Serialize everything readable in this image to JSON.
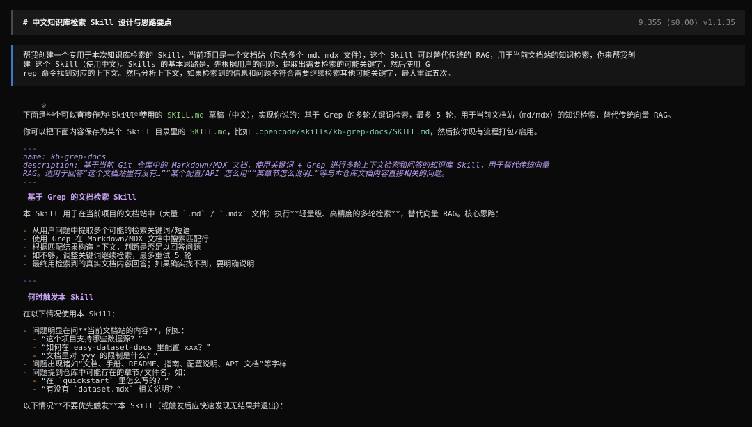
{
  "header": {
    "title": "# 中文知识库检索 Skill 设计与思路要点",
    "meta": "9,355 ($0.00) v1.1.35"
  },
  "prompt": {
    "lines": [
      "帮我创建一个专用于本次知识库检索的 Skill，当前项目是一个文档站（包含多个 md、mdx 文件），这个 Skill 可以替代传统的 RAG，用于当前文档站的知识检索，你来帮我创",
      "建 这个 Skill（使用中文）。Skills 的基本思路是，先根据用户的问题，提取出需要检索的可能关键字，然后使用 G",
      "rep 命令找到对应的上下文。然后分析上下文，如果检索到的信息和问题不符合需要继续检索其他可能关键字，最大重试五次。"
    ]
  },
  "tool_call": {
    "icon": "gear-icon",
    "label": "skill [name=skill-creator]"
  },
  "response": {
    "intro1_a": "下面是一个可以直接作为 Skill 使用的 ",
    "intro1_file": "SKILL.md",
    "intro1_b": " 草稿（中文），实现你说的：基于 Grep 的多轮关键词检索，最多 5 轮，用于当前文档站（md/mdx）的知识检索，替代传统向量 RAG。",
    "intro2_a": "你可以把下面内容保存为某个 Skill 目录里的 ",
    "intro2_file": "SKILL.md",
    "intro2_b": "，比如 ",
    "intro2_path": ".opencode/skills/kb-grep-docs/SKILL.md",
    "intro2_c": "，然后按你现有流程打包/启用。",
    "fm_rule_top": "---",
    "fm_name": "name: kb-grep-docs",
    "fm_desc1": "description: 基于当前 Git 仓库中的 Markdown/MDX 文档，使用关键词 + Grep 进行多轮上下文检索和问答的知识库 Skill，用于替代传统向量",
    "fm_desc2": "RAG。适用于回答“这个文档站里有没有…”“某个配置/API 怎么用”“某章节怎么说明…”等与本仓库文档内容直接相关的问题。",
    "fm_rule_bottom": "---",
    "h1": "基于 Grep 的文档检索 Skill",
    "p1": "本 Skill 用于在当前项目的文档站中（大量 `.md` / `.mdx` 文件）执行**轻量级、高精度的多轮检索**，替代向量 RAG。核心思路：",
    "list1": [
      "从用户问题中提取多个可能的检索关键词/短语",
      "使用 Grep 在 Markdown/MDX 文档中搜索匹配行",
      "根据匹配结果构造上下文，判断是否足以回答问题",
      "如不够，调整关键词继续检索，最多重试 5 轮",
      "最终用检索到的真实文档内容回答；如果确实找不到，要明确说明"
    ],
    "bullet_marker": "-",
    "rule2": "---",
    "h2": "何时触发本 Skill",
    "p2": "在以下情况使用本 Skill：",
    "list2": [
      {
        "level": 0,
        "text": "问题明显在问**当前文档站的内容**，例如："
      },
      {
        "level": 1,
        "text": "“这个项目支持哪些数据源？”"
      },
      {
        "level": 1,
        "text": "“如何在 easy-dataset-docs 里配置 xxx？”"
      },
      {
        "level": 1,
        "text": "“文档里对 yyy 的限制是什么？”"
      },
      {
        "level": 0,
        "text": "问题出现诸如“文档、手册、README、指南、配置说明、API 文档”等字样"
      },
      {
        "level": 0,
        "text": "问题提到仓库中可能存在的章节/文件名，如："
      },
      {
        "level": 1,
        "text": "“在 `quickstart` 里怎么写的？”"
      },
      {
        "level": 1,
        "text": "“有没有 `dataset.mdx` 相关说明？”"
      }
    ],
    "p3": "以下情况**不要优先触发**本 Skill（或触发后应快速发现无结果并退出）："
  }
}
